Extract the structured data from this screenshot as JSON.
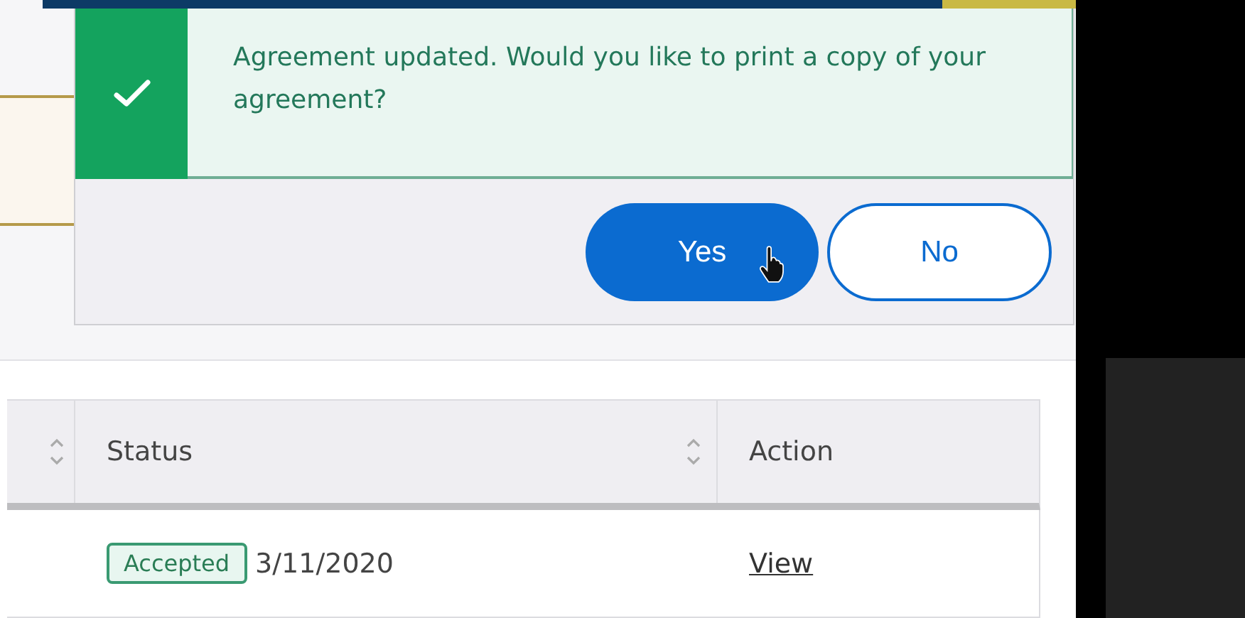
{
  "alert": {
    "kind": "success",
    "message": "Agreement updated. Would you like to print a copy of your agreement?"
  },
  "buttons": [
    {
      "label": "Yes",
      "kind": "primary",
      "hovered": true
    },
    {
      "label": "No",
      "kind": "secondary",
      "hovered": false
    }
  ],
  "table": {
    "columns": [
      {
        "sortable": true
      },
      {
        "label": "Status",
        "sortable": true
      },
      {
        "label": "Action",
        "sortable": false
      }
    ],
    "rows": [
      {
        "status": "Accepted",
        "date": "3/11/2020",
        "action": "View"
      }
    ]
  }
}
